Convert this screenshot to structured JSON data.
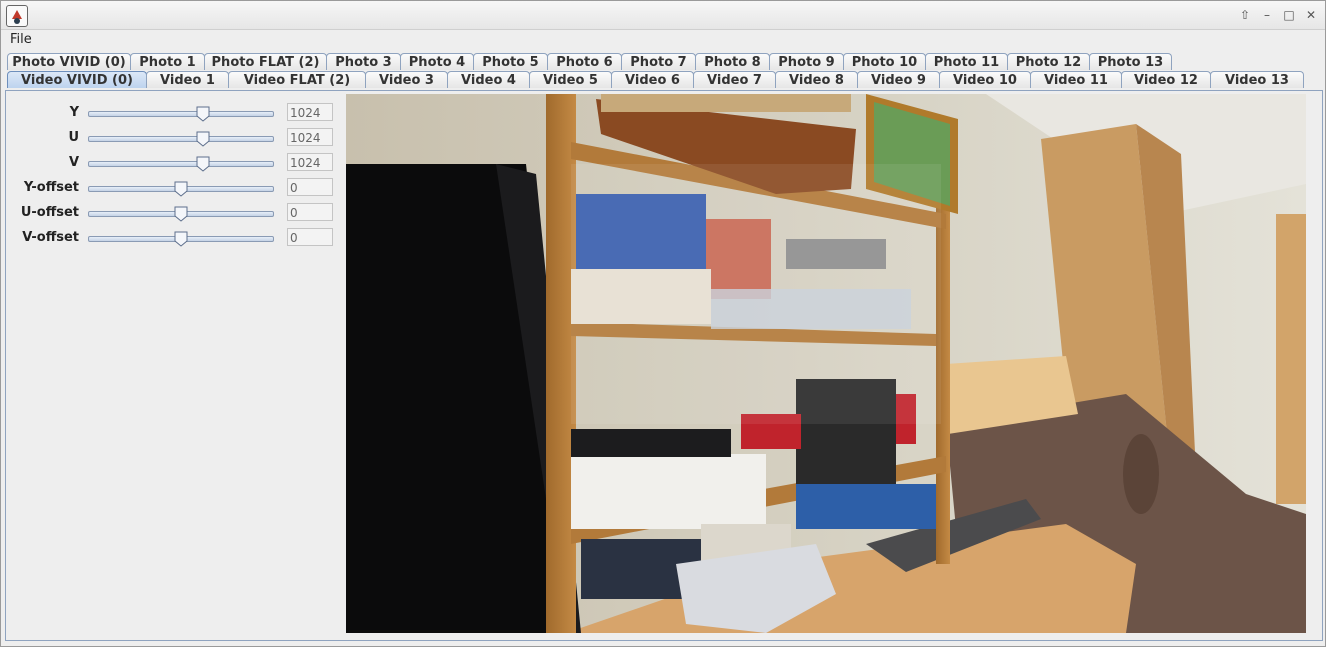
{
  "menu": {
    "file_label": "File"
  },
  "photo_tabs": [
    "Photo VIVID (0)",
    "Photo 1",
    "Photo FLAT (2)",
    "Photo 3",
    "Photo 4",
    "Photo 5",
    "Photo 6",
    "Photo 7",
    "Photo 8",
    "Photo 9",
    "Photo 10",
    "Photo 11",
    "Photo 12",
    "Photo 13"
  ],
  "video_tabs": [
    "Video VIVID (0)",
    "Video 1",
    "Video FLAT (2)",
    "Video 3",
    "Video 4",
    "Video 5",
    "Video 6",
    "Video 7",
    "Video 8",
    "Video 9",
    "Video 10",
    "Video 11",
    "Video 12",
    "Video 13"
  ],
  "selected_tab": "Video VIVID (0)",
  "sliders": [
    {
      "label": "Y",
      "value": "1024",
      "position": 0.62
    },
    {
      "label": "U",
      "value": "1024",
      "position": 0.62
    },
    {
      "label": "V",
      "value": "1024",
      "position": 0.62
    },
    {
      "label": "Y-offset",
      "value": "0",
      "position": 0.5
    },
    {
      "label": "U-offset",
      "value": "0",
      "position": 0.5
    },
    {
      "label": "V-offset",
      "value": "0",
      "position": 0.5
    }
  ],
  "colors": {
    "tab_border": "#8fa3bf",
    "selected_tab": "#bdd3ee"
  }
}
